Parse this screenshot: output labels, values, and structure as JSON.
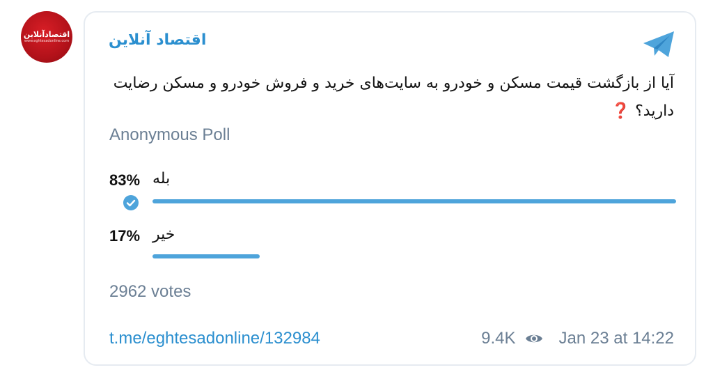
{
  "channel": {
    "logo_text": "اقتصادآنلاین",
    "logo_sub": "www.eghtesadonline.com",
    "name": "اقتصاد آنلاین"
  },
  "poll": {
    "question": "آیا از بازگشت قیمت مسکن و خودرو به سایت‌های خرید و فروش خودرو و مسکن رضایت دارید؟",
    "question_emoji": "❓",
    "type_label": "Anonymous Poll",
    "options": [
      {
        "label": "بله",
        "percent": "83%",
        "fraction": 0.83,
        "chosen": true
      },
      {
        "label": "خیر",
        "percent": "17%",
        "fraction": 0.17,
        "chosen": false
      }
    ],
    "votes": "2962 votes"
  },
  "footer": {
    "link": "t.me/eghtesadonline/132984",
    "views": "9.4K",
    "date": "Jan 23 at 14:22"
  },
  "colors": {
    "accent": "#2b8fcf",
    "bar": "#4ea4db",
    "muted": "#6b7f94",
    "avatar": "#c4161c",
    "question_mark": "#d62020"
  },
  "icons": [
    "telegram-icon",
    "check-icon",
    "eye-icon"
  ]
}
